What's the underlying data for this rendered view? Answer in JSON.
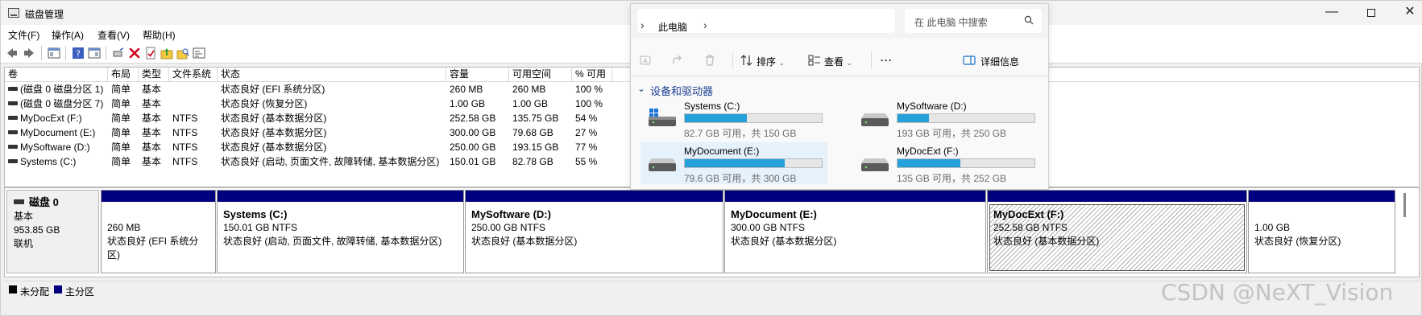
{
  "window": {
    "title": "磁盘管理",
    "minimize": "—",
    "close": "✕"
  },
  "menu": [
    "文件(F)",
    "操作(A)",
    "查看(V)",
    "帮助(H)"
  ],
  "volume_table": {
    "columns": [
      "卷",
      "布局",
      "类型",
      "文件系统",
      "状态",
      "容量",
      "可用空间",
      "% 可用"
    ],
    "rows": [
      [
        "(磁盘 0 磁盘分区 1)",
        "简单",
        "基本",
        "",
        "状态良好 (EFI 系统分区)",
        "260 MB",
        "260 MB",
        "100 %"
      ],
      [
        "(磁盘 0 磁盘分区 7)",
        "简单",
        "基本",
        "",
        "状态良好 (恢复分区)",
        "1.00 GB",
        "1.00 GB",
        "100 %"
      ],
      [
        "MyDocExt (F:)",
        "简单",
        "基本",
        "NTFS",
        "状态良好 (基本数据分区)",
        "252.58 GB",
        "135.75 GB",
        "54 %"
      ],
      [
        "MyDocument (E:)",
        "简单",
        "基本",
        "NTFS",
        "状态良好 (基本数据分区)",
        "300.00 GB",
        "79.68 GB",
        "27 %"
      ],
      [
        "MySoftware (D:)",
        "简单",
        "基本",
        "NTFS",
        "状态良好 (基本数据分区)",
        "250.00 GB",
        "193.15 GB",
        "77 %"
      ],
      [
        "Systems (C:)",
        "简单",
        "基本",
        "NTFS",
        "状态良好 (启动, 页面文件, 故障转储, 基本数据分区)",
        "150.01 GB",
        "82.78 GB",
        "55 %"
      ]
    ]
  },
  "disk": {
    "name": "磁盘 0",
    "type": "基本",
    "size": "953.85 GB",
    "status": "联机"
  },
  "partitions": [
    {
      "name": "",
      "size": "260 MB",
      "status": "状态良好 (EFI 系统分区)"
    },
    {
      "name": "Systems  (C:)",
      "size": "150.01 GB NTFS",
      "status": "状态良好 (启动, 页面文件, 故障转储, 基本数据分区)"
    },
    {
      "name": "MySoftware  (D:)",
      "size": "250.00 GB NTFS",
      "status": "状态良好 (基本数据分区)"
    },
    {
      "name": "MyDocument  (E:)",
      "size": "300.00 GB NTFS",
      "status": "状态良好 (基本数据分区)"
    },
    {
      "name": "MyDocExt  (F:)",
      "size": "252.58 GB NTFS",
      "status": "状态良好 (基本数据分区)"
    },
    {
      "name": "",
      "size": "1.00 GB",
      "status": "状态良好 (恢复分区)"
    }
  ],
  "legend": [
    {
      "label": "未分配",
      "color": "#000000"
    },
    {
      "label": "主分区",
      "color": "#000080"
    }
  ],
  "watermark": "CSDN @NeXT_Vision",
  "explorer": {
    "breadcrumb": "此电脑",
    "search_placeholder": "在 此电脑 中搜索",
    "commands": {
      "sort": "排序",
      "view": "查看",
      "more": "···",
      "details": "详细信息"
    },
    "section_title": "设备和驱动器",
    "drives": [
      {
        "name": "Systems (C:)",
        "info": "82.7 GB 可用，共 150 GB",
        "used_fraction": 0.45,
        "windows_logo": true
      },
      {
        "name": "MySoftware (D:)",
        "info": "193 GB 可用，共 250 GB",
        "used_fraction": 0.23,
        "windows_logo": false
      },
      {
        "name": "MyDocument (E:)",
        "info": "79.6 GB 可用，共 300 GB",
        "used_fraction": 0.73,
        "windows_logo": false
      },
      {
        "name": "MyDocExt (F:)",
        "info": "135 GB 可用，共 252 GB",
        "used_fraction": 0.46,
        "windows_logo": false
      }
    ],
    "accent": "#26a0da"
  }
}
